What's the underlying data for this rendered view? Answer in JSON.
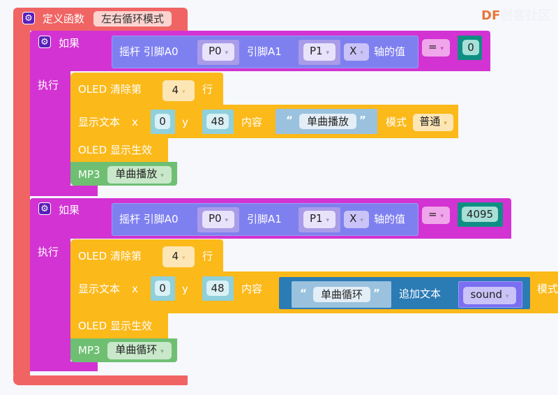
{
  "colors": {
    "function": "#f06464",
    "if_block": "#d233d2",
    "joystick": "#7f80f0",
    "oled": "#fbb91a",
    "mp3": "#6fbf73",
    "number": "#0f8f84",
    "text": "#2b7bb5",
    "background": "#f6f8fc"
  },
  "watermark": {
    "brand": "DF",
    "text": "创客社区"
  },
  "function_block": {
    "label": "定义函数",
    "name": "左右循环模式",
    "icon": "gear-icon"
  },
  "if_blocks": [
    {
      "if_label": "如果",
      "do_label": "执行",
      "condition": {
        "joystick_label": "摇杆 引脚A0",
        "pin_a0": "P0",
        "pin_a1_label": "引脚A1",
        "pin_a1": "P1",
        "axis": "X",
        "axis_label": "轴的值",
        "operator": "=",
        "value": "0"
      },
      "oled_clear": {
        "label": "OLED 清除第",
        "row": "4",
        "suffix": "行"
      },
      "show_text": {
        "label": "显示文本",
        "x_label": "x",
        "x": "0",
        "y_label": "y",
        "y": "48",
        "content_label": "内容",
        "content": "单曲播放",
        "mode_label": "模式",
        "mode": "普通"
      },
      "oled_apply": "OLED 显示生效",
      "mp3": {
        "label": "MP3",
        "mode": "单曲播放"
      }
    },
    {
      "if_label": "如果",
      "do_label": "执行",
      "condition": {
        "joystick_label": "摇杆 引脚A0",
        "pin_a0": "P0",
        "pin_a1_label": "引脚A1",
        "pin_a1": "P1",
        "axis": "X",
        "axis_label": "轴的值",
        "operator": "=",
        "value": "4095"
      },
      "oled_clear": {
        "label": "OLED 清除第",
        "row": "4",
        "suffix": "行"
      },
      "show_text": {
        "label": "显示文本",
        "x_label": "x",
        "x": "0",
        "y_label": "y",
        "y": "48",
        "content_label": "内容",
        "content": "单曲循环",
        "append_label": "追加文本",
        "append_var": "sound",
        "mode_label": "模式"
      },
      "oled_apply": "OLED 显示生效",
      "mp3": {
        "label": "MP3",
        "mode": "单曲循环"
      }
    }
  ]
}
